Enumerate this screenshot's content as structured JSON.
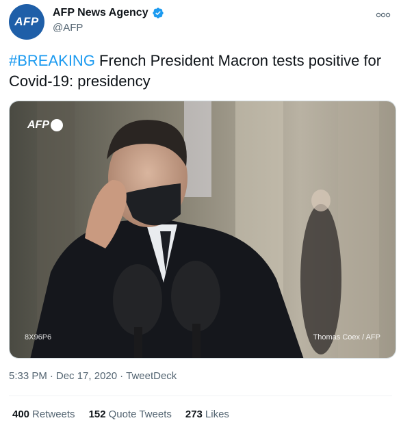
{
  "author": {
    "avatar_text": "AFP",
    "display_name": "AFP News Agency",
    "handle": "@AFP"
  },
  "tweet": {
    "hashtag": "#BREAKING",
    "text": " French President Macron tests positive for Covid-19: presidency"
  },
  "media": {
    "logo_text": "AFP",
    "image_id": "8X96P6",
    "credit": "Thomas Coex / AFP"
  },
  "meta": {
    "time": "5:33 PM",
    "separator1": "·",
    "date": "Dec 17, 2020",
    "separator2": "·",
    "source": "TweetDeck"
  },
  "stats": {
    "retweets_count": "400",
    "retweets_label": "Retweets",
    "quotes_count": "152",
    "quotes_label": "Quote Tweets",
    "likes_count": "273",
    "likes_label": "Likes"
  },
  "colors": {
    "accent": "#1d9bf0",
    "avatar_bg": "#1f5fa8"
  },
  "icons": {
    "verified": "verified-badge-icon",
    "more": "more-options-icon"
  }
}
